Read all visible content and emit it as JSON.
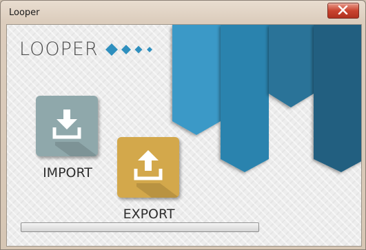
{
  "window": {
    "title": "Looper"
  },
  "logo": {
    "text": "LOOPER"
  },
  "actions": {
    "import_label": "IMPORT",
    "export_label": "EXPORT"
  },
  "icons": {
    "import": "download-icon",
    "export": "upload-icon",
    "close": "close-icon",
    "diamonds": "diamond-icon"
  },
  "colors": {
    "accent_blue": "#2e8fbe",
    "import_tile": "#8fa8ab",
    "export_tile": "#d3a84b",
    "close_button": "#c9442f"
  },
  "progress": {
    "value": 0
  }
}
